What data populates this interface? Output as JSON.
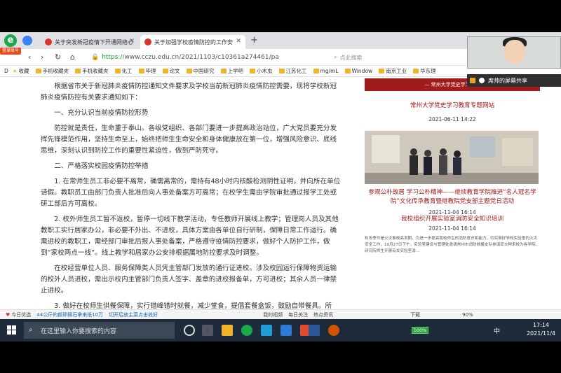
{
  "browser": {
    "login_badge": "登录账号",
    "tabs": [
      {
        "title": "关于突发新冠疫情下开通网络心"
      },
      {
        "title": "关于加强学校疫情防控的工作安"
      }
    ],
    "new_tab": "+",
    "url_protocol": "https://",
    "url_rest": "www.cczu.edu.cn/2021/1103/c10361a274461/pa",
    "search_placeholder": "点此搜索",
    "bookmarks": [
      "收藏",
      "手机收藏夹",
      "手机收藏夹",
      "化工",
      "毕理",
      "论文",
      "中国研究",
      "上学吧",
      "小木虫",
      "江苏化工",
      "mg/mL",
      "Window",
      "南京工业",
      "华东理"
    ]
  },
  "article": {
    "intro": "根据省市关于新冠肺炎疫情防控通知文件要求及学校当前新冠肺炎疫情防控需要，现将学校新冠肺炎疫情防控有关要求通知如下：",
    "h1": "一、充分认识当前疫情防控形势",
    "p1": "防控就是责任，生命重于泰山。各级党组织、各部门要进一步提高政治站位，广大党员要充分发挥先锋模范作用，坚持生命至上，始终把师生生命安全和身体健康放在第一位，增强风险意识、底线思维，深刻认识到防控工作的重要性紧迫性，做到严防死守。",
    "h2": "二、严格落实校园疫情防控举措",
    "p2": "1. 在常师生员工非必要不离常，确需离常的，需持有48小时内核酸检测阴性证明，并向所在单位请假。教职员工由部门负责人批准后向人事处备案方可离常；在校学生需由学院审批通过报学工处或研工部后方可离校。",
    "p3": "2. 校外师生员工暂不返校，暂停一切线下教学活动，专任教师开展线上教学；管理岗人员及其他教职工实行居家办公，非必要不外出、不进校，具体方案由各单位自行研制，保障日常工作运行。确需进校的教职工，需经部门审批后报人事处备案，严格遵守疫情防控要求，做好个人防护工作，做到“家校两点一线”。线上教学和居家办公安排根据属地防控要求及时调整。",
    "p4": "在校经营单位人员、服务保障类人员凭主管部门发放的通行证进校。涉及校园运行保障物资运输的校外人员进校，需出示校内主管部门负责人签字、盖章的进校报备单，方可进校；其余人员一律禁止进校。",
    "p5": "3. 做好在校师生供餐保障，实行错峰错时就餐，减少堂食，提倡套餐盒饭，鼓励自带餐具。所"
  },
  "sidebar": {
    "banner": "— 常州大学党史学习教育",
    "link1": "常州大学党史学习教育专题网站",
    "date1": "2021-06-11 14:22",
    "link2": "参观公朴故居 学习公朴精神——继续教育学院推进“名人冠名学院”文化传承教育暨继教院党支部主题党日活动",
    "date2": "2021-11-04 16:14",
    "link3": "我校组织开展实验室消防安全知识培训",
    "date3": "2021-11-04 16:14",
    "small_text": "秋冬季节是火灾事故高发期，为进一步提高我校师生的消防意识和能力，切实做好学校实验室的火灾安全工作，10月27日下午，实验室建设与管理处邀请常州市消防救援支队参谋邱文种来校为各学院、研究院师生开展有关实验室消..."
  },
  "statusbar": {
    "items": [
      "今日优选",
      "44公斤的额卵摘石拿来抵10万",
      "切开后放主菜点击收好",
      "我的视频",
      "每日关注",
      "热点资讯",
      "下载",
      "90%"
    ]
  },
  "taskbar": {
    "search_placeholder": "在这里输入你要搜索的内容",
    "battery": "100%",
    "ime": "中",
    "time": "17:14",
    "date": "2021/11/4"
  },
  "meeting": {
    "share_label": "席帅的屏幕共享"
  },
  "colors": {
    "accent_red": "#a11b1b",
    "taskbar": "#1e2b3a",
    "url_green": "#1a9b3b"
  }
}
